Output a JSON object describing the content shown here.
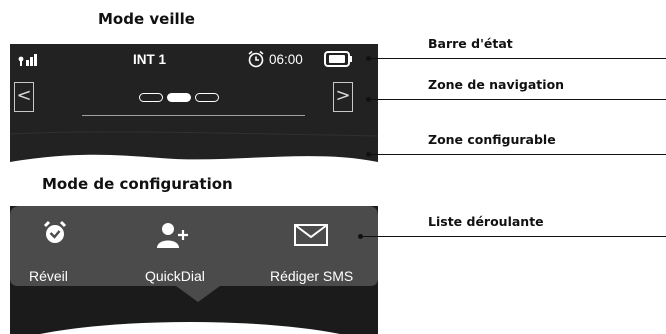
{
  "headings": {
    "standby": "Mode veille",
    "config": "Mode de configuration"
  },
  "status_bar": {
    "line": "INT 1",
    "time": "06:00",
    "icons": [
      "signal-icon",
      "alarm-clock-icon",
      "battery-icon"
    ]
  },
  "navigation": {
    "prev_label": "<",
    "next_label": ">",
    "pages": 3,
    "active_page": 2
  },
  "config_list": [
    {
      "label": "Réveil",
      "icon": "alarm-clock-icon"
    },
    {
      "label": "QuickDial",
      "icon": "add-contact-icon"
    },
    {
      "label": "Rédiger SMS",
      "icon": "envelope-icon"
    }
  ],
  "callouts": {
    "status_bar": "Barre d'état",
    "navigation_zone": "Zone de navigation",
    "configurable_zone": "Zone configurable",
    "scroll_list": "Liste déroulante"
  },
  "colors": {
    "screen": "#222222",
    "panel": "#4a4a4a",
    "text_on_screen": "#ffffff"
  }
}
